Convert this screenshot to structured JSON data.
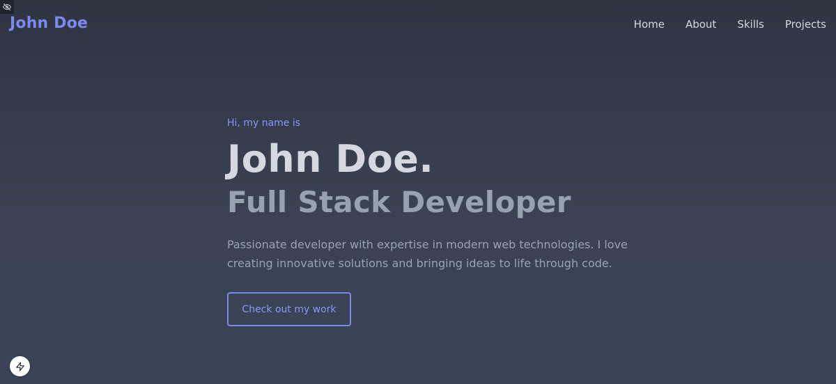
{
  "header": {
    "brand": "John Doe",
    "nav": [
      "Home",
      "About",
      "Skills",
      "Projects"
    ]
  },
  "hero": {
    "greeting": "Hi, my name is",
    "name": "John Doe.",
    "role": "Full Stack Developer",
    "description": "Passionate developer with expertise in modern web technologies. I love creating innovative solutions and bringing ideas to life through code.",
    "cta_label": "Check out my work"
  },
  "icons": {
    "top_left": "eye-off-icon",
    "bottom_left": "lightning-bolt-icon"
  },
  "colors": {
    "accent": "#7c89f0",
    "background": "#3a4253",
    "heading": "#d5d8e0",
    "subheading": "#98a1ae",
    "nav_text": "#d6d9e0"
  }
}
